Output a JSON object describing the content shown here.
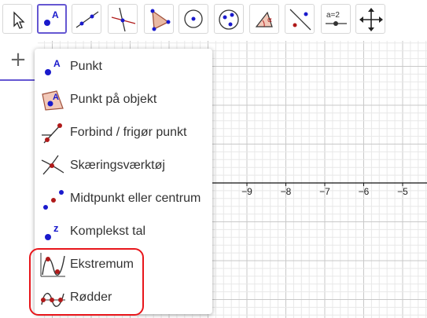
{
  "toolbar": {
    "tools": [
      {
        "name": "move-tool",
        "selected": false
      },
      {
        "name": "point-tool",
        "selected": true,
        "label": "A"
      },
      {
        "name": "line-tool",
        "selected": false
      },
      {
        "name": "perpendicular-line-tool",
        "selected": false
      },
      {
        "name": "polygon-tool",
        "selected": false
      },
      {
        "name": "circle-center-point-tool",
        "selected": false
      },
      {
        "name": "circle-three-points-tool",
        "selected": false
      },
      {
        "name": "angle-tool",
        "selected": false
      },
      {
        "name": "reflect-tool",
        "selected": false
      },
      {
        "name": "slider-tool",
        "selected": false,
        "label": "a=2"
      },
      {
        "name": "move-graphics-view-tool",
        "selected": false
      }
    ]
  },
  "left_panel": {
    "add_label": "+"
  },
  "menu": {
    "items": [
      {
        "id": "point",
        "label": "Punkt",
        "icon": "point-icon",
        "icon_letter": "A"
      },
      {
        "id": "point-on-object",
        "label": "Punkt på objekt",
        "icon": "point-on-object-icon",
        "icon_letter": "A"
      },
      {
        "id": "attach-detach",
        "label": "Forbind / frigør punkt",
        "icon": "attach-detach-point-icon"
      },
      {
        "id": "intersect",
        "label": "Skæringsværktøj",
        "icon": "intersect-icon"
      },
      {
        "id": "midpoint",
        "label": "Midtpunkt eller centrum",
        "icon": "midpoint-icon"
      },
      {
        "id": "complex",
        "label": "Komplekst tal",
        "icon": "complex-number-icon",
        "icon_letter": "z"
      },
      {
        "id": "extremum",
        "label": "Ekstremum",
        "icon": "extremum-icon"
      },
      {
        "id": "roots",
        "label": "Rødder",
        "icon": "roots-icon"
      }
    ]
  },
  "graphics": {
    "x_tick_labels": [
      "−9",
      "−8",
      "−7",
      "−6",
      "−5"
    ],
    "x_tick_values": [
      -9,
      -8,
      -7,
      -6,
      -5
    ]
  },
  "colors": {
    "accent": "#6557d2",
    "point_blue": "#1a1acc",
    "point_red": "#b01a1a",
    "annotation_red": "#e8161b",
    "grid_minor": "#e8e8e8",
    "grid_major": "#c8c8c8"
  }
}
